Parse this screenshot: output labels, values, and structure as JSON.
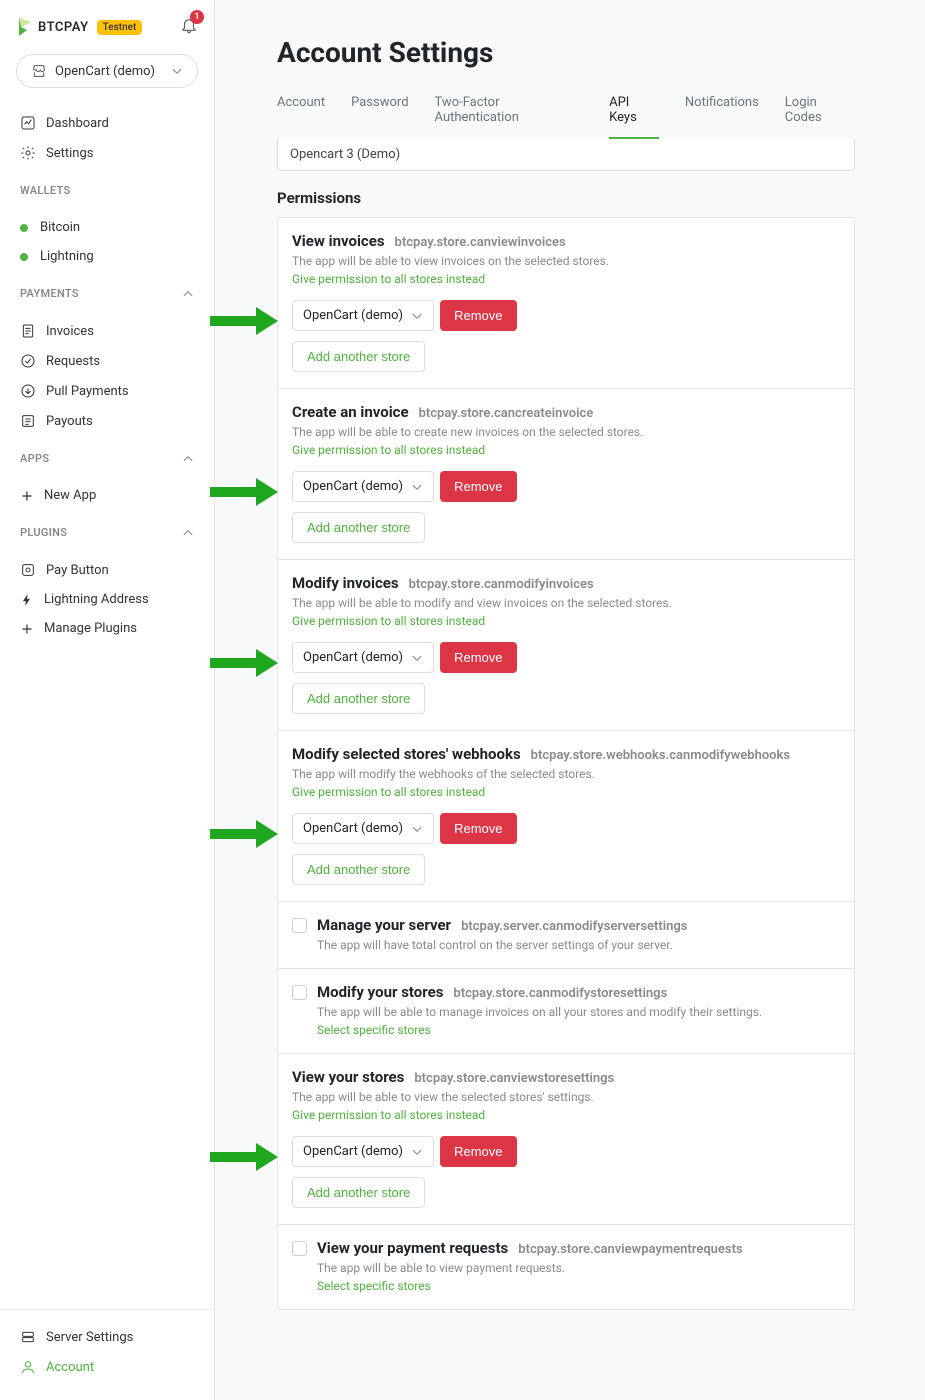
{
  "brand": {
    "name": "BTCPAY",
    "badge": "Testnet",
    "notification_count": "1"
  },
  "store_selector": {
    "label": "OpenCart (demo)"
  },
  "nav_primary": {
    "dashboard": "Dashboard",
    "settings": "Settings"
  },
  "sections": {
    "wallets": "WALLETS",
    "payments": "PAYMENTS",
    "apps": "APPS",
    "plugins": "PLUGINS"
  },
  "wallets": {
    "bitcoin": "Bitcoin",
    "lightning": "Lightning"
  },
  "payments": {
    "invoices": "Invoices",
    "requests": "Requests",
    "pull": "Pull Payments",
    "payouts": "Payouts"
  },
  "apps": {
    "new_app": "New App"
  },
  "plugins": {
    "paybutton": "Pay Button",
    "lightning_address": "Lightning Address",
    "manage": "Manage Plugins"
  },
  "footer_nav": {
    "server_settings": "Server Settings",
    "account": "Account"
  },
  "page": {
    "title": "Account Settings"
  },
  "tabs": {
    "account": "Account",
    "password": "Password",
    "twofa": "Two-Factor Authentication",
    "apikeys": "API Keys",
    "notifications": "Notifications",
    "logincodes": "Login Codes"
  },
  "api_name": "Opencart 3 (Demo)",
  "permissions_heading": "Permissions",
  "common": {
    "give_all": "Give permission to all stores instead",
    "select_specific": "Select specific stores",
    "store_option": "OpenCart (demo)",
    "remove": "Remove",
    "add": "Add another store"
  },
  "perms": [
    {
      "title": "View invoices",
      "code": "btcpay.store.canviewinvoices",
      "desc": "The app will be able to view invoices on the selected stores.",
      "mode": "picked",
      "arrow": true
    },
    {
      "title": "Create an invoice",
      "code": "btcpay.store.cancreateinvoice",
      "desc": "The app will be able to create new invoices on the selected stores.",
      "mode": "picked",
      "arrow": true
    },
    {
      "title": "Modify invoices",
      "code": "btcpay.store.canmodifyinvoices",
      "desc": "The app will be able to modify and view invoices on the selected stores.",
      "mode": "picked",
      "arrow": true
    },
    {
      "title": "Modify selected stores' webhooks",
      "code": "btcpay.store.webhooks.canmodifywebhooks",
      "desc": "The app will modify the webhooks of the selected stores.",
      "mode": "picked",
      "arrow": true
    },
    {
      "title": "Manage your server",
      "code": "btcpay.server.canmodifyserversettings",
      "desc": "The app will have total control on the server settings of your server.",
      "mode": "check"
    },
    {
      "title": "Modify your stores",
      "code": "btcpay.store.canmodifystoresettings",
      "desc": "The app will be able to manage invoices on all your stores and modify their settings.",
      "mode": "check_select"
    },
    {
      "title": "View your stores",
      "code": "btcpay.store.canviewstoresettings",
      "desc": "The app will be able to view the selected stores' settings.",
      "mode": "picked",
      "arrow": true
    },
    {
      "title": "View your payment requests",
      "code": "btcpay.store.canviewpaymentrequests",
      "desc": "The app will be able to view payment requests.",
      "mode": "check_select"
    }
  ]
}
